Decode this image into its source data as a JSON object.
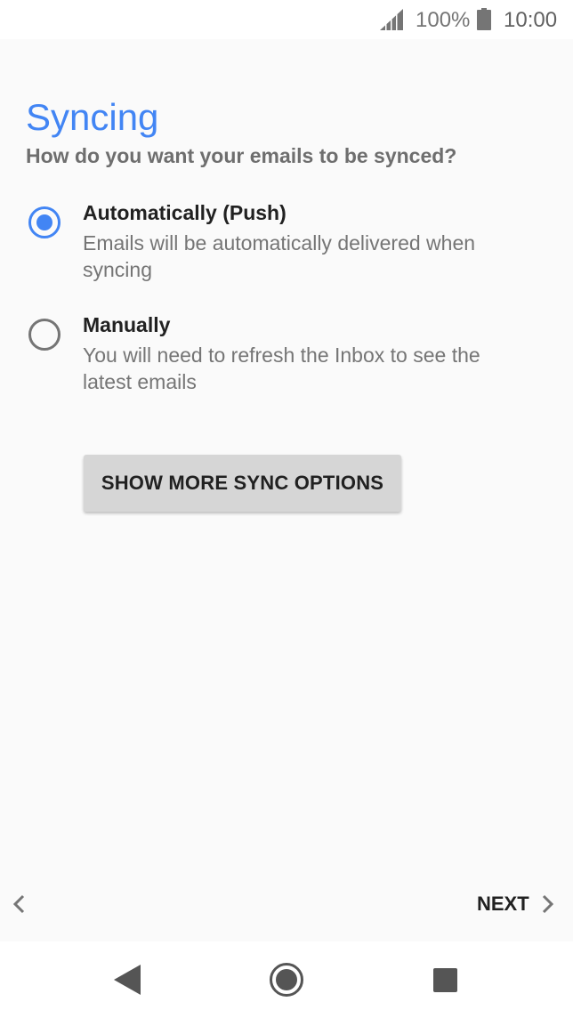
{
  "status_bar": {
    "battery_percent": "100%",
    "time": "10:00",
    "icons": [
      "signal-icon",
      "battery-icon"
    ]
  },
  "screen": {
    "title": "Syncing",
    "subtitle": "How do you want your emails to be synced?"
  },
  "options": [
    {
      "label": "Automatically (Push)",
      "description": "Emails will be automatically delivered when syncing",
      "selected": true
    },
    {
      "label": "Manually",
      "description": "You will need to refresh the Inbox to see the latest emails",
      "selected": false
    }
  ],
  "buttons": {
    "more_sync": "SHOW MORE SYNC OPTIONS",
    "next": "NEXT"
  },
  "nav_bar": {
    "icons": [
      "back-triangle-icon",
      "home-circle-icon",
      "recents-square-icon"
    ]
  },
  "colors": {
    "accent": "#4285f4",
    "background": "#fafafa"
  }
}
